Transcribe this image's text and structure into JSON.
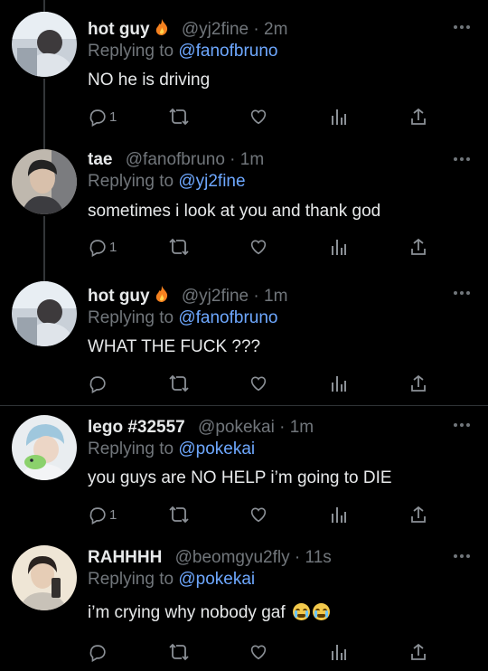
{
  "tweets": [
    {
      "name": "hot guy",
      "name_emoji": "fire",
      "handle": "@yj2fine",
      "time": "2m",
      "reply_prefix": "Replying to",
      "reply_to": "@fanofbruno",
      "text": "NO he is driving",
      "reply_count": "1",
      "avatar": "avatar-photo-hotguy"
    },
    {
      "name": "tae",
      "handle": "@fanofbruno",
      "time": "1m",
      "reply_prefix": "Replying to",
      "reply_to": "@yj2fine",
      "text": "sometimes i look at you and thank god",
      "reply_count": "1",
      "avatar": "avatar-photo-tae"
    },
    {
      "name": "hot guy",
      "name_emoji": "fire",
      "handle": "@yj2fine",
      "time": "1m",
      "reply_prefix": "Replying to",
      "reply_to": "@fanofbruno",
      "text": "WHAT THE FUCK ???",
      "reply_count": "",
      "avatar": "avatar-photo-hotguy"
    },
    {
      "name": "lego #32557",
      "handle": "@pokekai",
      "time": "1m",
      "reply_prefix": "Replying to",
      "reply_to": "@pokekai",
      "text": "you guys are NO HELP i’m going to DIE",
      "reply_count": "1",
      "avatar": "avatar-photo-lego"
    },
    {
      "name": "RAHHHH",
      "handle": "@beomgyu2fly",
      "time": "11s",
      "reply_prefix": "Replying to",
      "reply_to": "@pokekai",
      "text": "i’m crying why nobody gaf",
      "text_emoji": [
        "loudly-crying-face",
        "loudly-crying-face"
      ],
      "reply_count": "",
      "avatar": "avatar-photo-rahhhh"
    }
  ],
  "separator": "·",
  "colors": {
    "background": "#000000",
    "text": "#e7e9ea",
    "muted": "#71767b",
    "mention": "#6ea8ff",
    "divider": "#2f3336"
  },
  "icons": [
    "reply-icon",
    "retweet-icon",
    "like-icon",
    "views-icon",
    "share-icon",
    "more-icon"
  ]
}
